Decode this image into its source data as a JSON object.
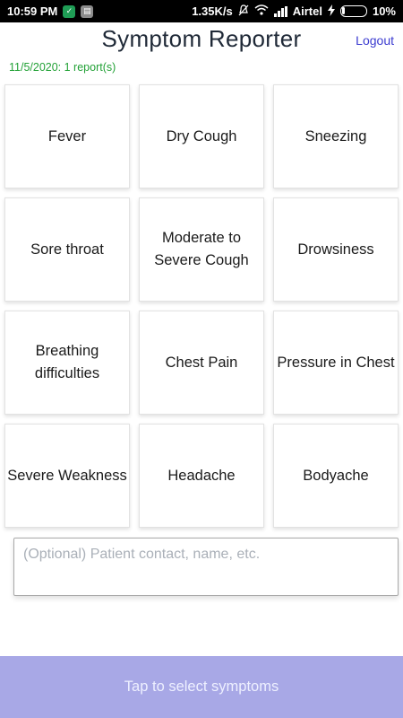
{
  "status_bar": {
    "time": "10:59 PM",
    "net_speed": "1.35K/s",
    "carrier": "Airtel",
    "battery": "10%",
    "icons": [
      "shield-icon",
      "sim-card-icon",
      "mute-icon",
      "wifi-icon",
      "signal-icon",
      "charging-icon",
      "battery-icon"
    ]
  },
  "header": {
    "title": "Symptom Reporter",
    "logout_label": "Logout"
  },
  "report_info": "11/5/2020: 1 report(s)",
  "symptoms": [
    "Fever",
    "Dry Cough",
    "Sneezing",
    "Sore throat",
    "Moderate to Severe Cough",
    "Drowsiness",
    "Breathing difficulties",
    "Chest Pain",
    "Pressure in Chest",
    "Severe Weakness",
    "Headache",
    "Bodyache"
  ],
  "notes": {
    "placeholder": "(Optional) Patient contact, name, etc.",
    "value": ""
  },
  "submit_label": "Tap to select symptoms",
  "colors": {
    "title": "#1f2937",
    "link": "#3b3bd0",
    "report_info": "#22a136",
    "button_bg": "#a8a8e6",
    "button_text": "#eef0ff"
  }
}
